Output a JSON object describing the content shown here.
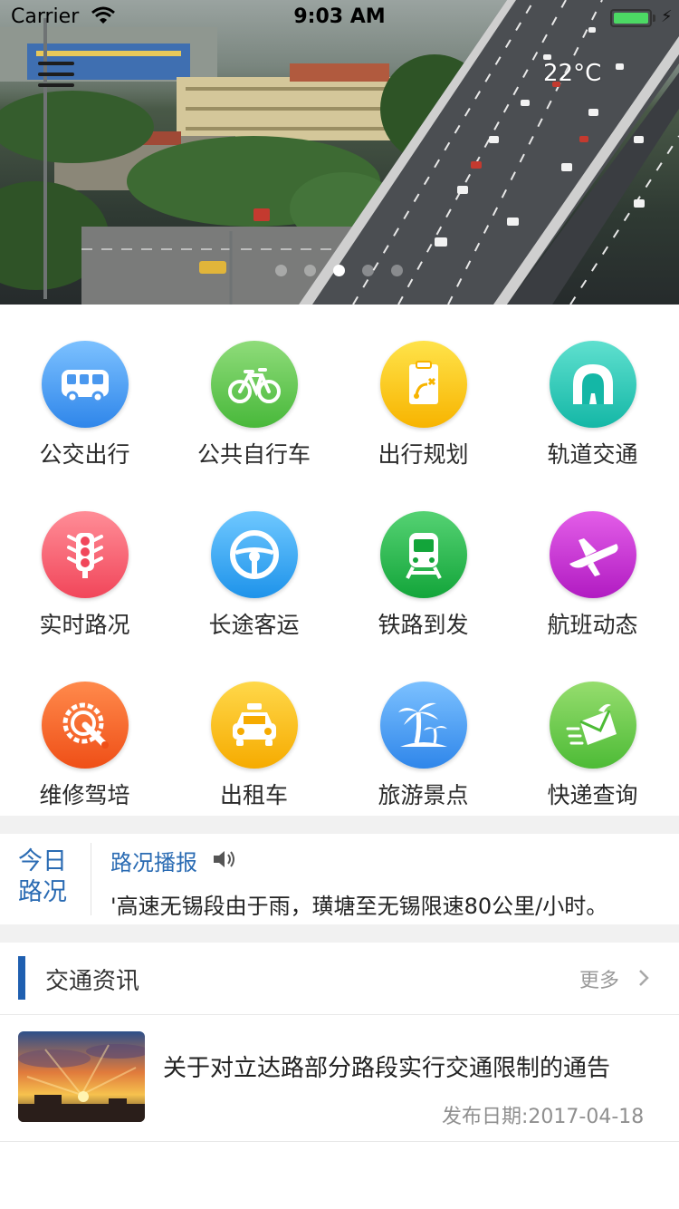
{
  "status_bar": {
    "carrier": "Carrier",
    "time": "9:03 AM"
  },
  "hero": {
    "temperature": "22°C",
    "carousel_count": 5,
    "active_index": 2
  },
  "services": [
    {
      "label": "公交出行",
      "icon": "bus-icon",
      "color_top": "#7cc1ff",
      "color_bottom": "#2f86ea"
    },
    {
      "label": "公共自行车",
      "icon": "bicycle-icon",
      "color_top": "#8fdc7a",
      "color_bottom": "#48b83a"
    },
    {
      "label": "出行规划",
      "icon": "route-plan-icon",
      "color_top": "#ffe34a",
      "color_bottom": "#f7b400"
    },
    {
      "label": "轨道交通",
      "icon": "tunnel-icon",
      "color_top": "#5fe0cf",
      "color_bottom": "#14b7a6"
    },
    {
      "label": "实时路况",
      "icon": "traffic-light-icon",
      "color_top": "#ff8d97",
      "color_bottom": "#f1465a"
    },
    {
      "label": "长途客运",
      "icon": "steering-wheel-icon",
      "color_top": "#6fc8ff",
      "color_bottom": "#1e93ea"
    },
    {
      "label": "铁路到发",
      "icon": "train-icon",
      "color_top": "#55d273",
      "color_bottom": "#13a53a"
    },
    {
      "label": "航班动态",
      "icon": "airplane-icon",
      "color_top": "#e35ee8",
      "color_bottom": "#b11bc2"
    },
    {
      "label": "维修驾培",
      "icon": "repair-icon",
      "color_top": "#ff8a4c",
      "color_bottom": "#ef4f17"
    },
    {
      "label": "出租车",
      "icon": "taxi-icon",
      "color_top": "#ffd84a",
      "color_bottom": "#f6ab00"
    },
    {
      "label": "旅游景点",
      "icon": "palm-tree-icon",
      "color_top": "#7cc1ff",
      "color_bottom": "#2f86ea"
    },
    {
      "label": "快递查询",
      "icon": "express-icon",
      "color_top": "#96dd6e",
      "color_bottom": "#4dbb36"
    }
  ],
  "broadcast": {
    "label": "今日路况",
    "title": "路况播报",
    "text": "'高速无锡段由于雨，璜塘至无锡限速80公里/小时。"
  },
  "news": {
    "section_title": "交通资讯",
    "more_label": "更多",
    "items": [
      {
        "headline": "关于对立达路部分路段实行交通限制的通告",
        "date": "发布日期:2017-04-18"
      }
    ]
  },
  "colors": {
    "accent": "#1f5fb0",
    "link": "#2a6bb3",
    "divider": "#f1f1f1"
  }
}
